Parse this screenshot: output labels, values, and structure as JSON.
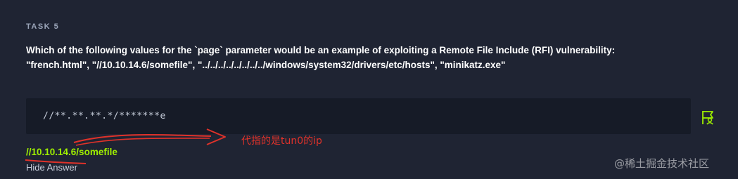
{
  "task": {
    "label": "TASK 5",
    "question": "Which of the following values for the `page` parameter would be an example of exploiting a Remote File Include (RFI) vulnerability: \"french.html\", \"//10.10.14.6/somefile\", \"../../../../../../../../windows/system32/drivers/etc/hosts\", \"minikatz.exe\"",
    "answer_input_value": "//**.**.**.*/*******e",
    "revealed_answer": "//10.10.14.6/somefile",
    "hide_answer_label": "Hide Answer"
  },
  "annotation": {
    "note": "代指的是tun0的ip",
    "color": "#e0322a"
  },
  "watermark": "@稀土掘金技术社区",
  "icons": {
    "flag": "flag-icon"
  },
  "colors": {
    "background": "#1f2433",
    "answer_box": "#161b27",
    "accent_green": "#9fef00"
  }
}
